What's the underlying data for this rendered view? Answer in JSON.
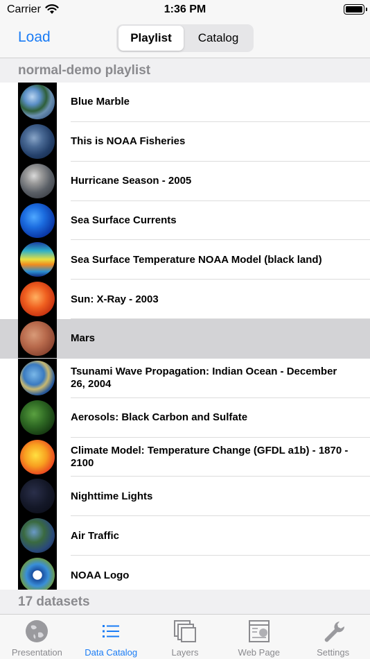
{
  "status_bar": {
    "carrier": "Carrier",
    "time": "1:36 PM"
  },
  "nav": {
    "load_label": "Load",
    "segments": [
      "Playlist",
      "Catalog"
    ],
    "selected_segment": "Playlist"
  },
  "playlist": {
    "header": "normal-demo playlist",
    "items": [
      {
        "label": "Blue Marble",
        "thumb": "blue-marble-globe"
      },
      {
        "label": "This is NOAA Fisheries",
        "thumb": "fisheries-globe"
      },
      {
        "label": "Hurricane Season - 2005",
        "thumb": "hurricane-globe"
      },
      {
        "label": "Sea Surface Currents",
        "thumb": "currents-globe"
      },
      {
        "label": "Sea Surface Temperature NOAA Model (black land)",
        "thumb": "sst-globe"
      },
      {
        "label": "Sun: X-Ray - 2003",
        "thumb": "sun-globe"
      },
      {
        "label": "Mars",
        "thumb": "mars-globe",
        "selected": true
      },
      {
        "label": "Tsunami Wave Propagation: Indian Ocean - December 26, 2004",
        "thumb": "tsunami-globe"
      },
      {
        "label": "Aerosols: Black Carbon and Sulfate",
        "thumb": "aerosols-globe"
      },
      {
        "label": "Climate Model: Temperature Change (GFDL a1b) - 1870 - 2100",
        "thumb": "climate-globe"
      },
      {
        "label": "Nighttime Lights",
        "thumb": "night-lights-globe"
      },
      {
        "label": "Air Traffic",
        "thumb": "air-traffic-globe"
      },
      {
        "label": "NOAA Logo",
        "thumb": "noaa-logo-globe"
      }
    ],
    "footer": "17 datasets"
  },
  "tabs": [
    {
      "label": "Presentation",
      "icon": "globe-icon"
    },
    {
      "label": "Data Catalog",
      "icon": "list-icon",
      "active": true
    },
    {
      "label": "Layers",
      "icon": "layers-icon"
    },
    {
      "label": "Web Page",
      "icon": "web-page-icon"
    },
    {
      "label": "Settings",
      "icon": "wrench-icon"
    }
  ],
  "colors": {
    "accent": "#1a7cf5",
    "selected_row": "#d3d3d6",
    "section_header_text": "#8a8a8e"
  }
}
